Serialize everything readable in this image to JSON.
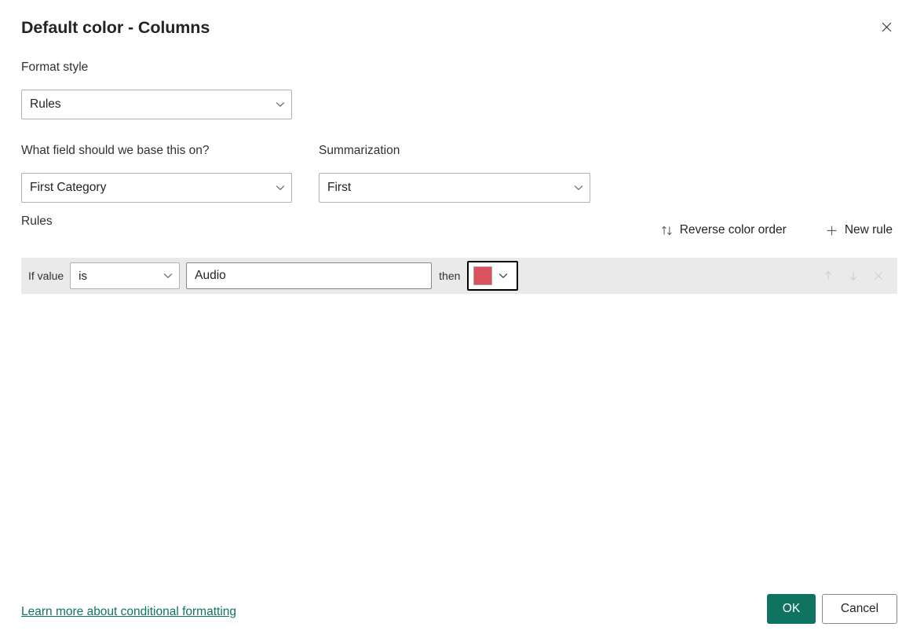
{
  "dialog": {
    "title": "Default color - Columns",
    "close_icon": "close-icon"
  },
  "format_style": {
    "label": "Format style",
    "value": "Rules"
  },
  "base_field": {
    "label": "What field should we base this on?",
    "value": "First Category"
  },
  "summarization": {
    "label": "Summarization",
    "value": "First"
  },
  "rules_section": {
    "label": "Rules",
    "reverse_color_order": {
      "label": "Reverse color order",
      "icon": "sort-updown-icon"
    },
    "new_rule": {
      "label": "New rule",
      "icon": "plus-icon"
    },
    "rows": [
      {
        "if_label": "If value",
        "operator": "is",
        "value": "Audio",
        "then_label": "then",
        "color": "#d9525e",
        "tools": [
          "move-up-icon",
          "move-down-icon",
          "delete-icon"
        ]
      }
    ]
  },
  "footer": {
    "learn_more": "Learn more about conditional formatting",
    "ok": "OK",
    "cancel": "Cancel"
  },
  "colors": {
    "accent": "#0f7362",
    "rule_row_background": "#eaeaea",
    "rule_color_swatch": "#d9525e"
  }
}
